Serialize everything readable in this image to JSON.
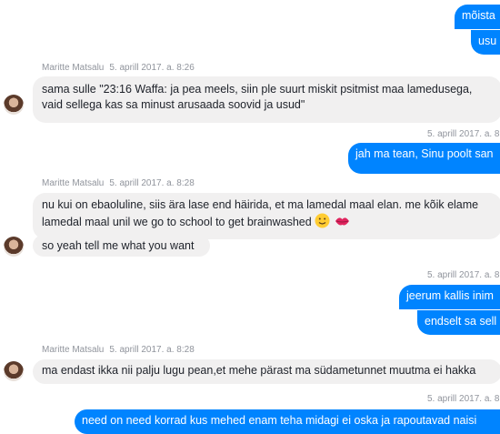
{
  "messages": [
    {
      "kind": "out",
      "text": "mõista"
    },
    {
      "kind": "out",
      "text": "usu"
    },
    {
      "kind": "meta",
      "sender": "Maritte Matsalu",
      "time": "5. aprill 2017. a. 8:26"
    },
    {
      "kind": "in",
      "lines": [
        "sama sulle \"23:16 Waffa: ja pea meels, siin ple suurt miskit psitmist maa lamedusega,",
        "vaid sellega kas sa minust arusaada soovid ja  usud\""
      ]
    },
    {
      "kind": "ts",
      "time": "5. aprill 2017. a. 8"
    },
    {
      "kind": "out",
      "text": "jah ma tean, Sinu poolt san"
    },
    {
      "kind": "meta",
      "sender": "Maritte Matsalu",
      "time": "5. aprill 2017. a. 8:28"
    },
    {
      "kind": "in",
      "lines": [
        "nu kui on ebaoluline, siis ära lase end häirida, et ma lamedal maal elan. me kõik elame",
        "lamedal maal unil we go to school to get brainwashed"
      ]
    },
    {
      "kind": "in",
      "text": "so yeah tell me what you want"
    },
    {
      "kind": "ts",
      "time": "5. aprill 2017. a. 8"
    },
    {
      "kind": "out",
      "text": "jeerum kallis inim"
    },
    {
      "kind": "out",
      "text": "endselt sa sell"
    },
    {
      "kind": "meta",
      "sender": "Maritte Matsalu",
      "time": "5. aprill 2017. a. 8:28"
    },
    {
      "kind": "in",
      "text": "ma endast ikka nii palju lugu pean,et mehe pärast ma südametunnet muutma ei hakka"
    },
    {
      "kind": "ts",
      "time": "5. aprill 2017. a. 8"
    },
    {
      "kind": "out",
      "text": "need on need korrad kus mehed enam teha midagi ei oska ja rapoutavad naisi"
    }
  ],
  "emoji": {
    "smile": "slightly-smiling-face",
    "kiss": "kiss-mark"
  }
}
